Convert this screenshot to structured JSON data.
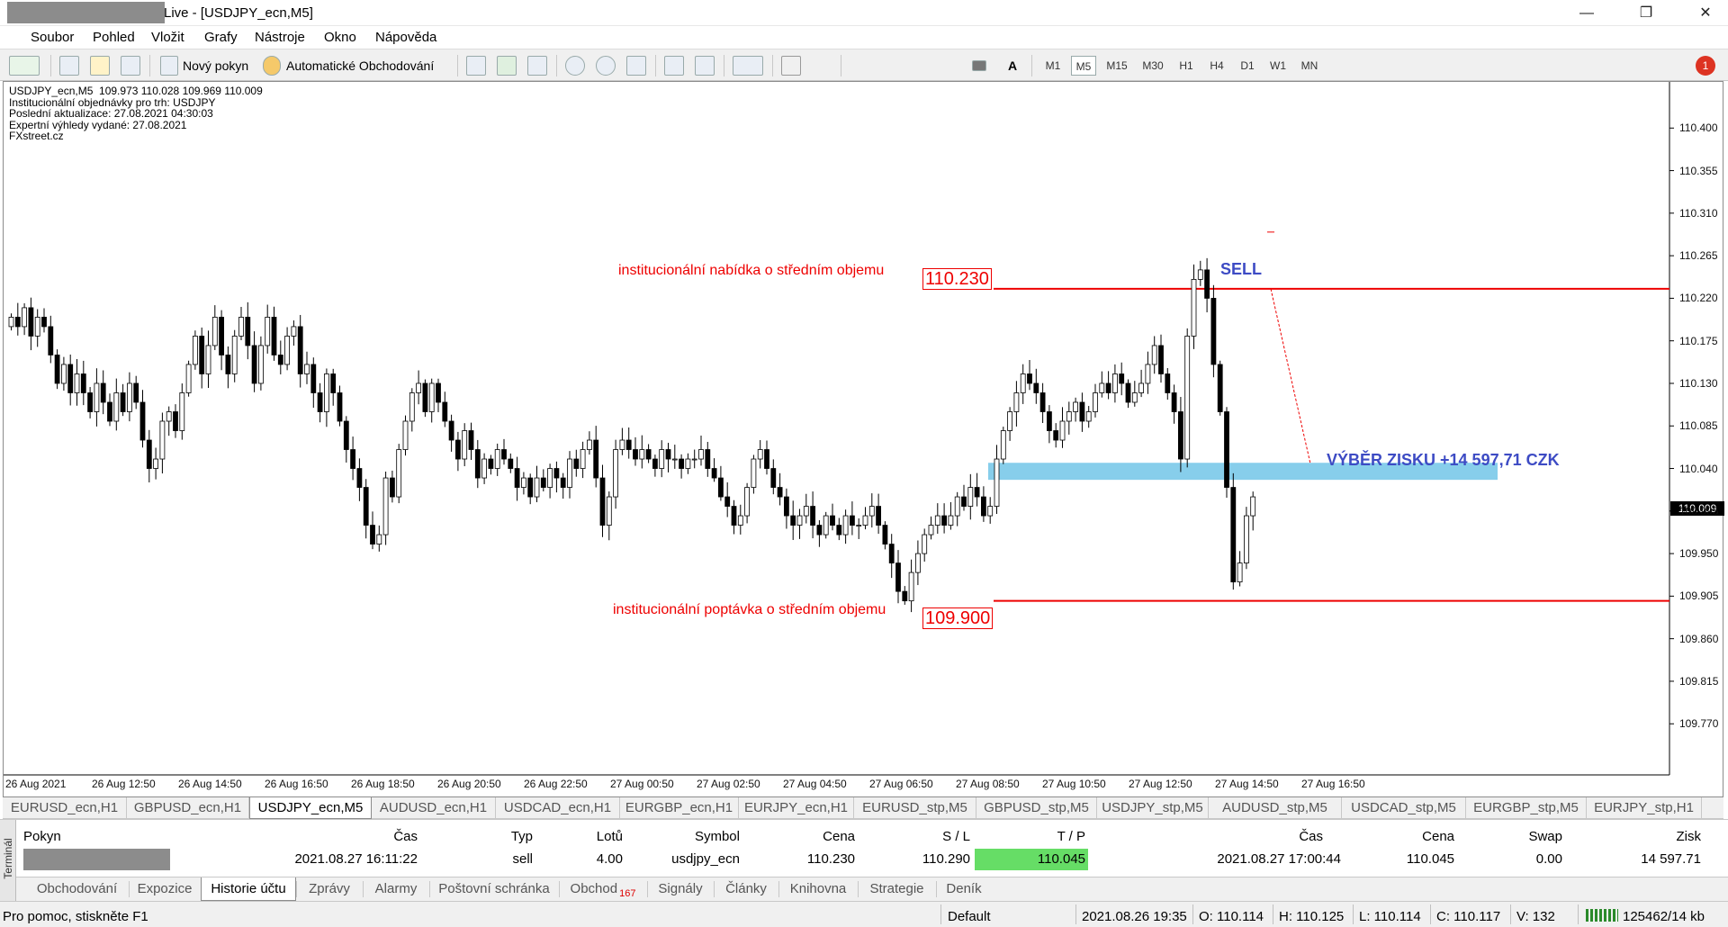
{
  "window": {
    "title": "Live - [USDJPY_ecn,M5]",
    "minimize": "—",
    "restore": "❐",
    "close": "✕"
  },
  "menu": [
    "Soubor",
    "Pohled",
    "Vložit",
    "Grafy",
    "Nástroje",
    "Okno",
    "Nápověda"
  ],
  "toolbar": {
    "new_order": "Nový pokyn",
    "auto_trading": "Automatické Obchodování",
    "text_tool": "A",
    "timeframes": [
      "M1",
      "M5",
      "M15",
      "M30",
      "H1",
      "H4",
      "D1",
      "W1",
      "MN"
    ],
    "active_timeframe": "M5",
    "notification_count": "1"
  },
  "chart_info": "USDJPY_ecn,M5  109.973 110.028 109.969 110.009\nInstitucionální objednávky pro trh: USDJPY\nPoslední aktualizace: 27.08.2021 04:30:03\nExpertní výhledy vydané: 27.08.2021\nFXstreet.cz",
  "annotations": {
    "upper_text": "institucionální nabídka o středním objemu",
    "upper_price": "110.230",
    "lower_text": "institucionální poptávka o středním objemu",
    "lower_price": "109.900",
    "sell": "SELL",
    "profit": "VÝBĚR ZISKU +14 597,71 CZK",
    "current_price": "110.009"
  },
  "chart_data": {
    "type": "candlestick",
    "symbol": "USDJPY_ecn",
    "timeframe": "M5",
    "ylim": [
      109.735,
      110.445
    ],
    "y_ticks": [
      "110.400",
      "110.355",
      "110.310",
      "110.265",
      "110.220",
      "110.175",
      "110.130",
      "110.085",
      "110.040",
      "109.995",
      "109.950",
      "109.905",
      "109.860",
      "109.815",
      "109.770"
    ],
    "x_ticks": [
      "26 Aug 2021",
      "26 Aug 12:50",
      "26 Aug 14:50",
      "26 Aug 16:50",
      "26 Aug 18:50",
      "26 Aug 20:50",
      "26 Aug 22:50",
      "27 Aug 00:50",
      "27 Aug 02:50",
      "27 Aug 04:50",
      "27 Aug 06:50",
      "27 Aug 08:50",
      "27 Aug 10:50",
      "27 Aug 12:50",
      "27 Aug 14:50",
      "27 Aug 16:50"
    ],
    "closes": [
      110.2,
      110.19,
      110.21,
      110.18,
      110.2,
      110.19,
      110.16,
      110.13,
      110.15,
      110.12,
      110.14,
      110.12,
      110.1,
      110.13,
      110.11,
      110.09,
      110.12,
      110.1,
      110.13,
      110.11,
      110.07,
      110.04,
      110.05,
      110.09,
      110.1,
      110.08,
      110.12,
      110.15,
      110.18,
      110.14,
      110.17,
      110.2,
      110.16,
      110.14,
      110.18,
      110.2,
      110.17,
      110.13,
      110.17,
      110.2,
      110.16,
      110.15,
      110.18,
      110.19,
      110.14,
      110.15,
      110.12,
      110.1,
      110.14,
      110.12,
      110.09,
      110.06,
      110.04,
      110.02,
      109.98,
      109.96,
      109.97,
      110.03,
      110.01,
      110.06,
      110.09,
      110.12,
      110.13,
      110.1,
      110.13,
      110.11,
      110.09,
      110.07,
      110.05,
      110.08,
      110.06,
      110.03,
      110.05,
      110.04,
      110.06,
      110.05,
      110.04,
      110.02,
      110.03,
      110.01,
      110.03,
      110.02,
      110.04,
      110.03,
      110.02,
      110.05,
      110.04,
      110.06,
      110.07,
      110.03,
      109.98,
      110.01,
      110.06,
      110.07,
      110.06,
      110.05,
      110.06,
      110.05,
      110.04,
      110.06,
      110.05,
      110.05,
      110.04,
      110.05,
      110.05,
      110.06,
      110.04,
      110.03,
      110.01,
      110.0,
      109.98,
      109.99,
      110.02,
      110.05,
      110.06,
      110.04,
      110.02,
      110.01,
      109.99,
      109.98,
      109.99,
      110.0,
      109.98,
      109.97,
      109.99,
      109.98,
      109.97,
      109.99,
      109.98,
      109.98,
      109.99,
      110.0,
      109.98,
      109.96,
      109.94,
      109.91,
      109.9,
      109.93,
      109.95,
      109.97,
      109.98,
      109.99,
      109.98,
      109.99,
      110.01,
      110.0,
      110.02,
      110.01,
      109.99,
      110.0,
      110.05,
      110.08,
      110.1,
      110.12,
      110.14,
      110.13,
      110.12,
      110.1,
      110.08,
      110.07,
      110.09,
      110.1,
      110.11,
      110.09,
      110.1,
      110.12,
      110.13,
      110.12,
      110.14,
      110.13,
      110.11,
      110.12,
      110.13,
      110.15,
      110.17,
      110.14,
      110.12,
      110.1,
      110.05,
      110.18,
      110.24,
      110.25,
      110.22,
      110.15,
      110.1,
      110.02,
      109.92,
      109.94,
      109.99,
      110.01
    ]
  },
  "chart_tabs": [
    "EURUSD_ecn,H1",
    "GBPUSD_ecn,H1",
    "USDJPY_ecn,M5",
    "AUDUSD_ecn,H1",
    "USDCAD_ecn,H1",
    "EURGBP_ecn,H1",
    "EURJPY_ecn,H1",
    "EURUSD_stp,M5",
    "GBPUSD_stp,M5",
    "USDJPY_stp,M5",
    "AUDUSD_stp,M5",
    "USDCAD_stp,M5",
    "EURGBP_stp,M5",
    "EURJPY_stp,H1"
  ],
  "terminal": {
    "side_label": "Terminál",
    "columns": [
      "Pokyn",
      "Čas",
      "Typ",
      "Lotů",
      "Symbol",
      "Cena",
      "S / L",
      "T / P",
      "Čas",
      "Cena",
      "Swap",
      "Zisk"
    ],
    "row": {
      "time_open": "2021.08.27 16:11:22",
      "type": "sell",
      "lots": "4.00",
      "symbol": "usdjpy_ecn",
      "price_open": "110.230",
      "sl": "110.290",
      "tp": "110.045",
      "time_close": "2021.08.27 17:00:44",
      "price_close": "110.045",
      "swap": "0.00",
      "profit": "14 597.71"
    },
    "tabs": [
      "Obchodování",
      "Expozice",
      "Historie účtu",
      "Zprávy",
      "Alarmy",
      "Poštovní schránka",
      "Obchod",
      "Signály",
      "Články",
      "Knihovna",
      "Strategie",
      "Deník"
    ],
    "trade_badge": "167"
  },
  "status": {
    "help": "Pro pomoc, stiskněte F1",
    "profile": "Default",
    "datetime": "2021.08.26 19:35",
    "open": "O: 110.114",
    "high": "H: 110.125",
    "low": "L: 110.114",
    "close": "C: 110.117",
    "volume": "V: 132",
    "traffic": "125462/14 kb"
  }
}
